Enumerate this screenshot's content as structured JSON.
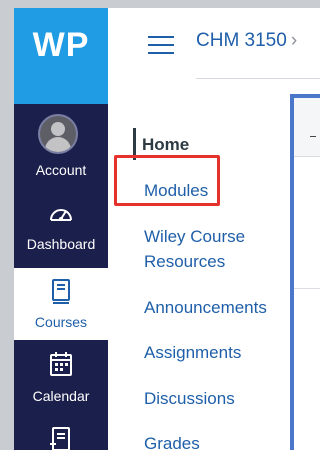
{
  "logo": {
    "text": "WP"
  },
  "global_nav": {
    "account": "Account",
    "dashboard": "Dashboard",
    "courses": "Courses",
    "calendar": "Calendar"
  },
  "breadcrumb": {
    "course": "CHM 3150",
    "separator": "›"
  },
  "course_nav": {
    "items": [
      {
        "label": "Home"
      },
      {
        "label": "Modules"
      },
      {
        "label": "Wiley Course"
      },
      {
        "label": "Resources"
      },
      {
        "label": "Announcements"
      },
      {
        "label": "Assignments"
      },
      {
        "label": "Discussions"
      },
      {
        "label": "Grades"
      }
    ]
  },
  "colors": {
    "nav_bg": "#1b1f4b",
    "logo_bg": "#1f9ce4",
    "link": "#1f5fa9",
    "highlight": "#e5322d"
  }
}
